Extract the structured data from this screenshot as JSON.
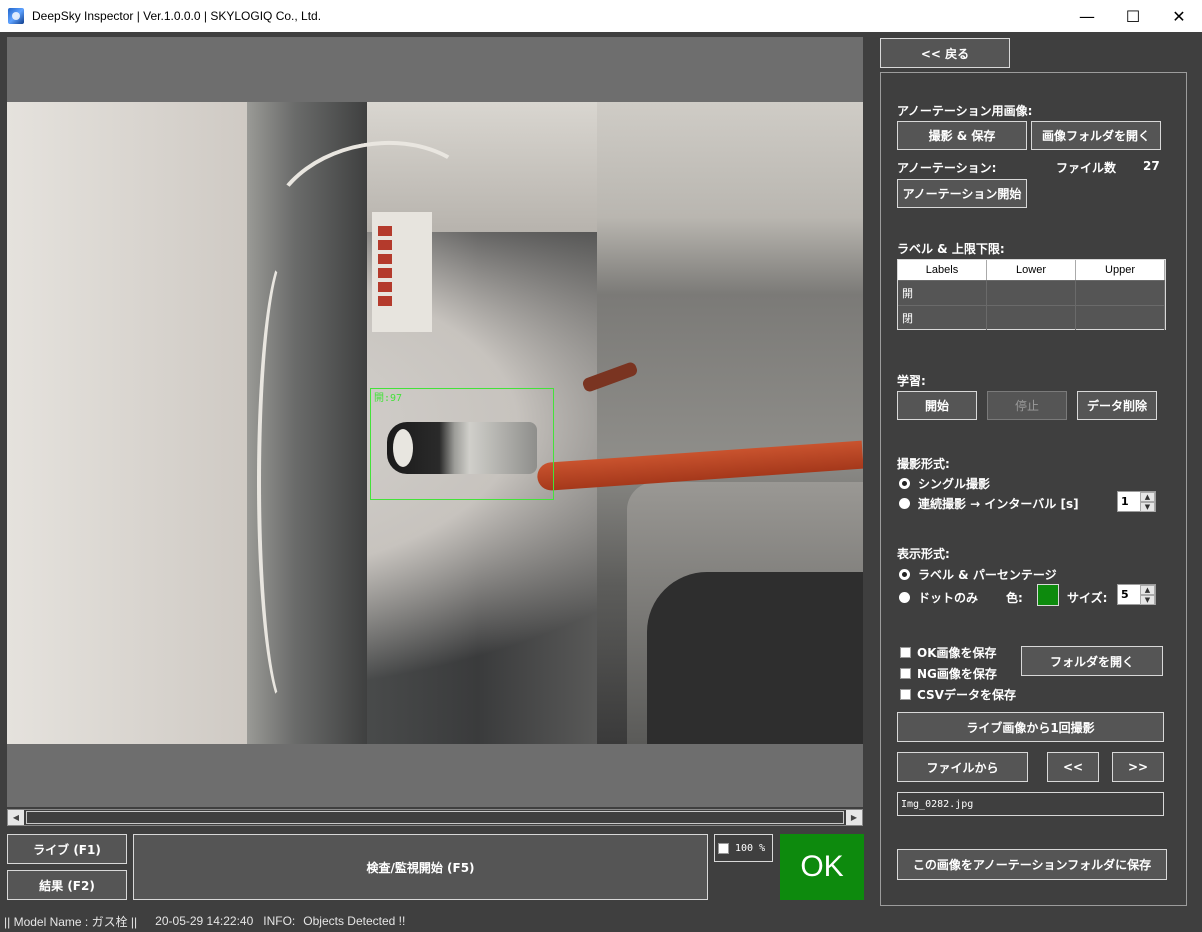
{
  "window": {
    "title": "DeepSky Inspector | Ver.1.0.0.0 | SKYLOGIQ Co., Ltd.",
    "minimize": "—",
    "maximize": "☐",
    "close": "✕"
  },
  "detection": {
    "label": "開:97",
    "color": "#44e23a"
  },
  "bottom": {
    "live_button": "ライブ (F1)",
    "result_button": "結果 (F2)",
    "inspect_button": "検査/監視開始 (F5)",
    "zoom_value": "100 %",
    "ok_label": "OK",
    "ok_color": "#0d8a0d"
  },
  "status": {
    "model": "|| Model Name : ガス栓 ||",
    "timestamp": "20-05-29 14:22:40",
    "info_label": "INFO:",
    "info_text": "Objects Detected !!"
  },
  "side": {
    "back_button": "<< 戻る",
    "annot_image_label": "アノーテーション用画像:",
    "capture_save_button": "撮影 & 保存",
    "open_image_folder_button": "画像フォルダを開く",
    "annotation_label": "アノーテーション:",
    "file_count_label": "ファイル数",
    "file_count_value": "27",
    "annotation_start_button": "アノーテーション開始",
    "labels_limits_label": "ラベル & 上限下限:",
    "table": {
      "headers": [
        "Labels",
        "Lower",
        "Upper"
      ],
      "rows": [
        [
          "開",
          "",
          ""
        ],
        [
          "閉",
          "",
          ""
        ]
      ]
    },
    "learning_label": "学習:",
    "start_button": "開始",
    "stop_button": "停止",
    "delete_data_button": "データ削除",
    "capture_mode_label": "撮影形式:",
    "single_capture": "シングル撮影",
    "continuous_capture": "連続撮影 → インターバル [s]",
    "interval_value": "1",
    "display_mode_label": "表示形式:",
    "label_percentage": "ラベル & パーセンテージ",
    "dot_only": "ドットのみ",
    "color_label": "色:",
    "dot_color": "#0d8a0d",
    "size_label": "サイズ:",
    "size_value": "5",
    "save_ok_images": "OK画像を保存",
    "save_ng_images": "NG画像を保存",
    "save_csv": "CSVデータを保存",
    "open_folder_button": "フォルダを開く",
    "capture_once_button": "ライブ画像から1回撮影",
    "from_file_button": "ファイルから",
    "prev_button": "<<",
    "next_button": ">>",
    "file_name": "Img_0282.jpg",
    "save_to_annotation_button": "この画像をアノーテーションフォルダに保存"
  }
}
